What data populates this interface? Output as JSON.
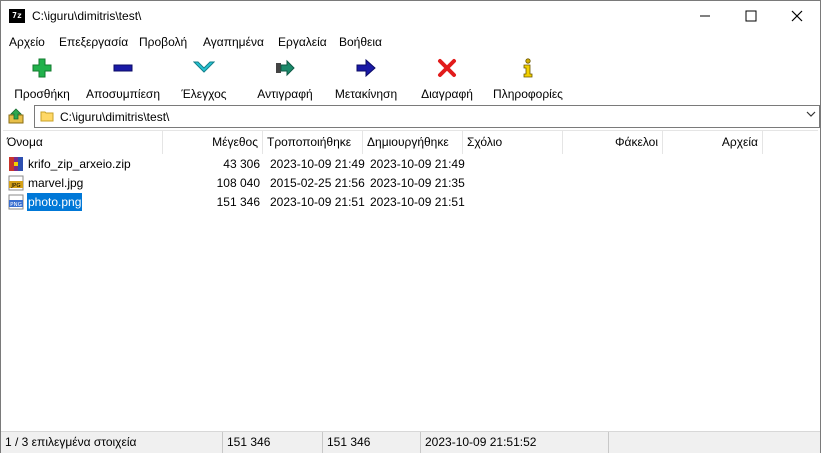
{
  "window": {
    "title": "C:\\iguru\\dimitris\\test\\",
    "app_icon_text": "7z"
  },
  "menu": [
    "Αρχείο",
    "Επεξεργασία",
    "Προβολή",
    "Αγαπημένα",
    "Εργαλεία",
    "Βοήθεια"
  ],
  "toolbar": [
    {
      "label": "Προσθήκη",
      "icon": "plus-icon",
      "color": "#22b14c"
    },
    {
      "label": "Αποσυμπίεση",
      "icon": "minus-icon",
      "color": "#1a1aa6"
    },
    {
      "label": "Έλεγχος",
      "icon": "check-chevron-icon",
      "color": "#27c4d4"
    },
    {
      "label": "Αντιγραφή",
      "icon": "copy-arrow-icon",
      "color": "#1b8a6b"
    },
    {
      "label": "Μετακίνηση",
      "icon": "move-arrow-icon",
      "color": "#1a1aa6"
    },
    {
      "label": "Διαγραφή",
      "icon": "delete-x-icon",
      "color": "#e21b1b"
    },
    {
      "label": "Πληροφορίες",
      "icon": "info-icon",
      "color": "#d4b000"
    }
  ],
  "address": {
    "path": "C:\\iguru\\dimitris\\test\\"
  },
  "columns": [
    "Όνομα",
    "Μέγεθος",
    "Τροποποιήθηκε",
    "Δημιουργήθηκε",
    "Σχόλιο",
    "Φάκελοι",
    "Αρχεία"
  ],
  "files": [
    {
      "name": "krifo_zip_arxeio.zip",
      "size": "43 306",
      "modified": "2023-10-09 21:49",
      "created": "2023-10-09 21:49",
      "icon": "zip-file-icon",
      "selected": false
    },
    {
      "name": "marvel.jpg",
      "size": "108 040",
      "modified": "2015-02-25 21:56",
      "created": "2023-10-09 21:35",
      "icon": "jpg-file-icon",
      "selected": false
    },
    {
      "name": "photo.png",
      "size": "151 346",
      "modified": "2023-10-09 21:51",
      "created": "2023-10-09 21:51",
      "icon": "png-file-icon",
      "selected": true
    }
  ],
  "status": {
    "selection": "1 / 3 επιλεγμένα στοιχεία",
    "size": "151 346",
    "packed": "151 346",
    "date": "2023-10-09 21:51:52"
  },
  "colors": {
    "selection": "#0078d7",
    "status_bg": "#f0f0f0"
  }
}
